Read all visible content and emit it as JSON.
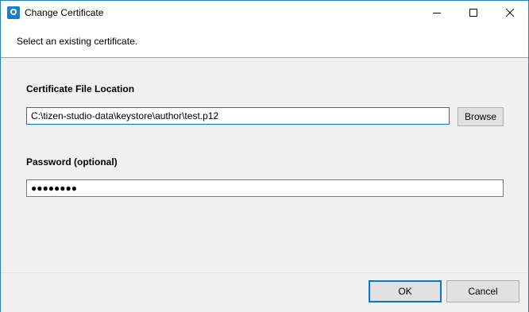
{
  "window": {
    "title": "Change Certificate",
    "app_icon": "certificate-badge-icon",
    "controls": {
      "minimize": "minimize-icon",
      "maximize": "maximize-icon",
      "close": "close-icon"
    }
  },
  "header": {
    "subtitle": "Select an existing certificate."
  },
  "form": {
    "cert_label": "Certificate File Location",
    "cert_path": "C:\\tizen-studio-data\\keystore\\author\\test.p12",
    "browse_label": "Browse",
    "password_label": "Password (optional)",
    "password_mask": "●●●●●●●●"
  },
  "footer": {
    "ok_label": "OK",
    "cancel_label": "Cancel"
  },
  "colors": {
    "accent": "#0078d7",
    "window_border": "#1883d7",
    "background": "#f0f0f0"
  }
}
